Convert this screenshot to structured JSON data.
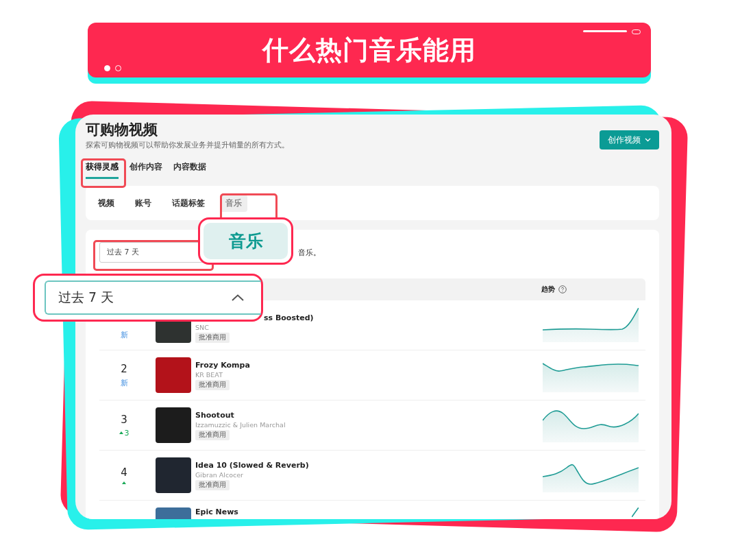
{
  "banner": {
    "title": "什么热门音乐能用",
    "dots": [
      {
        "selected": true
      },
      {
        "selected": false
      }
    ]
  },
  "screen": {
    "title": "可购物视频",
    "subtitle": "探索可购物视频可以帮助你发展业务并提升销量的所有方式。",
    "create_button": "创作视频",
    "tabs": [
      {
        "label": "获得灵感",
        "selected": true
      },
      {
        "label": "创作内容",
        "selected": false
      },
      {
        "label": "内容数据",
        "selected": false
      }
    ],
    "subtabs": [
      {
        "label": "视频",
        "selected": false
      },
      {
        "label": "账号",
        "selected": false
      },
      {
        "label": "话题标签",
        "selected": false
      },
      {
        "label": "音乐",
        "selected": true
      }
    ],
    "period_select": {
      "value": "过去 7 天"
    },
    "description": "音乐。",
    "table": {
      "trend_column": "趋势",
      "rows": [
        {
          "change": {
            "kind": "new",
            "text": "新"
          },
          "title": "ss Boosted)",
          "artist": "SNC",
          "badge": "批准商用"
        },
        {
          "rank": "2",
          "change": {
            "kind": "new",
            "text": "新"
          },
          "title": "Frozy Kompa",
          "artist": "KR BEAT",
          "badge": "批准商用"
        },
        {
          "rank": "3",
          "change": {
            "kind": "up",
            "text": "3"
          },
          "title": "Shootout",
          "artist": "Izzamuzzic & Julien Marchal",
          "badge": "批准商用"
        },
        {
          "rank": "4",
          "change": {
            "kind": "up"
          },
          "title": "Idea 10 (Slowed & Reverb)",
          "artist": "Gibran Alcocer",
          "badge": "批准商用"
        },
        {
          "title": "Epic News"
        }
      ]
    }
  },
  "callouts": {
    "tab": "音乐",
    "select": "过去 7 天"
  }
}
